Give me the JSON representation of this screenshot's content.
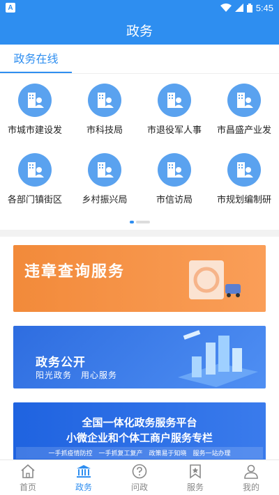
{
  "status_bar": {
    "badge": "A",
    "time": "5:45"
  },
  "header": {
    "title": "政务"
  },
  "section": {
    "tab_label": "政务在线"
  },
  "services": [
    {
      "label": "市城市建设发"
    },
    {
      "label": "市科技局"
    },
    {
      "label": "市退役军人事"
    },
    {
      "label": "市昌盛产业发"
    },
    {
      "label": "各部门镇街区"
    },
    {
      "label": "乡村振兴局"
    },
    {
      "label": "市信访局"
    },
    {
      "label": "市规划编制研"
    }
  ],
  "banners": {
    "violation": {
      "title": "违章查询服务"
    },
    "gov_open": {
      "title": "政务公开",
      "subtitle": "阳光政务　用心服务"
    },
    "platform": {
      "line1": "全国一体化政务服务平台",
      "line2": "小微企业和个体工商户服务专栏",
      "line3": "一手抓疫情防控　一手抓复工复产　政策易于知晓　服务一站办理"
    }
  },
  "bottom_nav": [
    {
      "label": "首页",
      "icon": "home-icon"
    },
    {
      "label": "政务",
      "icon": "government-icon",
      "active": true
    },
    {
      "label": "问政",
      "icon": "question-icon"
    },
    {
      "label": "服务",
      "icon": "service-icon"
    },
    {
      "label": "我的",
      "icon": "user-icon"
    }
  ],
  "colors": {
    "accent": "#2e8ef0",
    "icon_bg": "#5aa2ef",
    "banner_orange": "#f28a3a",
    "banner_blue": "#2e6de0"
  }
}
